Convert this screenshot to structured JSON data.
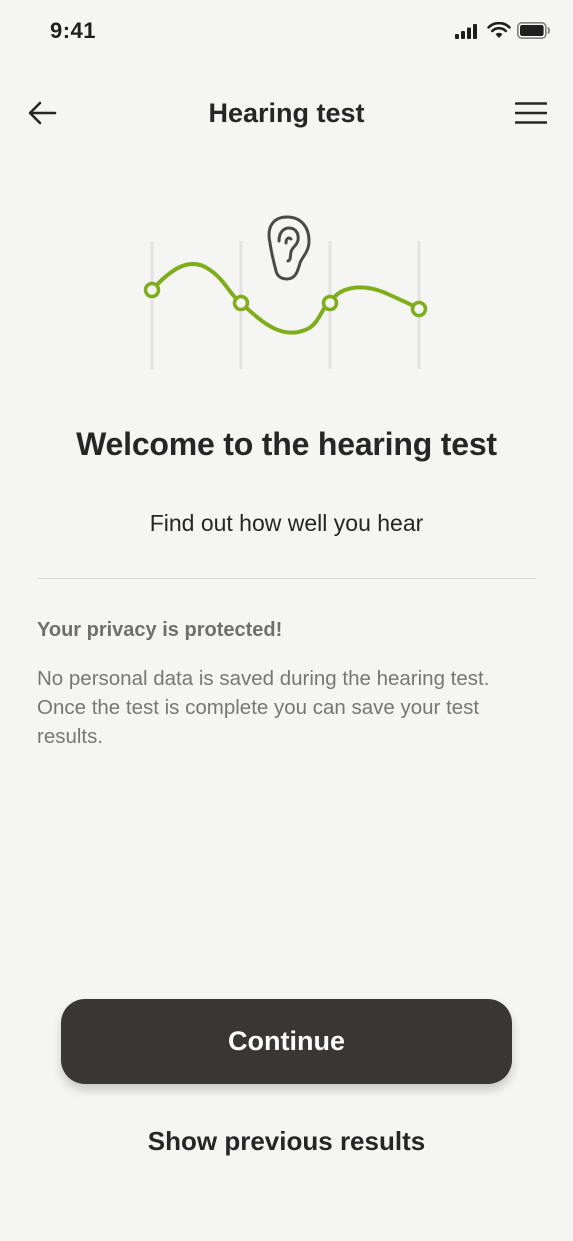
{
  "status_bar": {
    "time": "9:41",
    "icons": [
      "signal-icon",
      "wifi-icon",
      "battery-icon"
    ]
  },
  "nav": {
    "title": "Hearing test",
    "back_icon": "arrow-left-icon",
    "menu_icon": "hamburger-menu-icon"
  },
  "illustration": {
    "icon": "ear-icon",
    "curve_color": "#7fad1c",
    "grid_color": "#e2e2e0"
  },
  "main": {
    "headline": "Welcome to the hearing test",
    "subtitle": "Find out how well you hear",
    "privacy_heading": "Your privacy is protected!",
    "privacy_body": "No personal data is saved during the hearing test. Once the test is complete you can save your test results."
  },
  "actions": {
    "continue_label": "Continue",
    "previous_results_label": "Show previous results"
  },
  "colors": {
    "background": "#f5f5f3",
    "button": "#383735",
    "accent_green": "#7fad1c"
  }
}
